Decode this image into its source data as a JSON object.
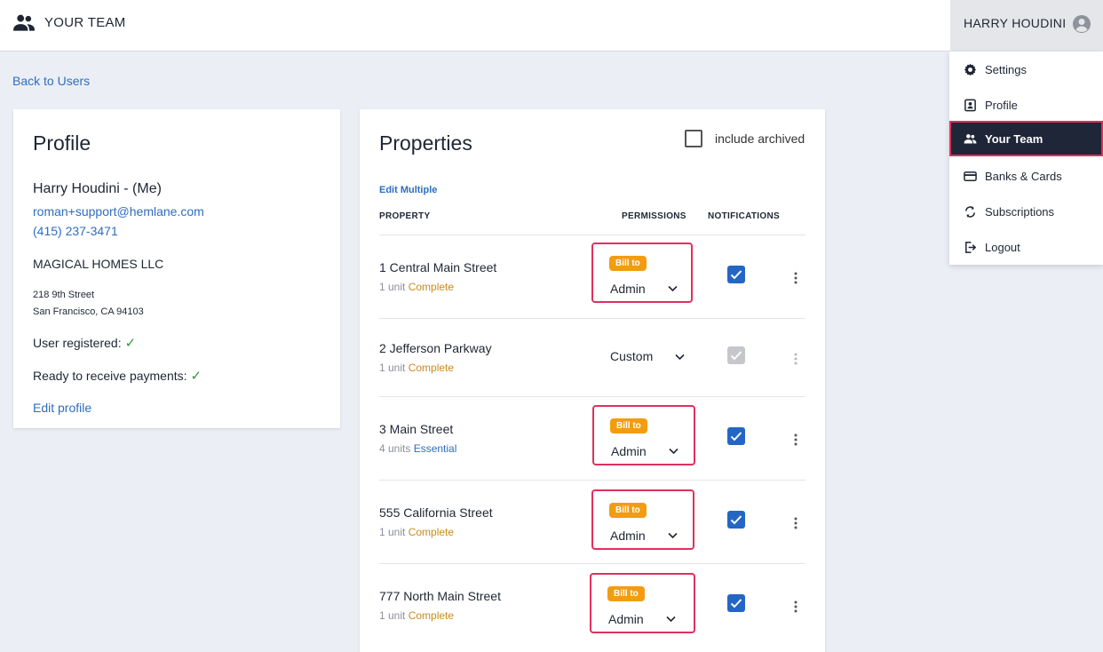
{
  "header": {
    "title": "YOUR TEAM",
    "user_name": "HARRY HOUDINI"
  },
  "menu": {
    "items": [
      {
        "label": "Settings",
        "icon": "gear-icon"
      },
      {
        "label": "Profile",
        "icon": "profile-card-icon"
      },
      {
        "label": "Your Team",
        "icon": "team-icon",
        "active": true
      },
      {
        "label": "Banks & Cards",
        "icon": "credit-card-icon"
      },
      {
        "label": "Subscriptions",
        "icon": "refresh-icon"
      },
      {
        "label": "Logout",
        "icon": "logout-icon"
      }
    ]
  },
  "back_link": "Back to Users",
  "profile": {
    "heading": "Profile",
    "name": "Harry Houdini - (Me)",
    "email": "roman+support@hemlane.com",
    "phone": "(415) 237-3471",
    "company": "MAGICAL HOMES LLC",
    "address_line1": "218 9th Street",
    "address_line2": "San Francisco, CA 94103",
    "registered_label": "User registered:",
    "payments_label": "Ready to receive payments:",
    "check_glyph": "✓",
    "edit_label": "Edit profile"
  },
  "properties": {
    "heading": "Properties",
    "include_archived_label": "include archived",
    "edit_multiple_label": "Edit Multiple",
    "columns": {
      "property": "PROPERTY",
      "permissions": "PERMISSIONS",
      "notifications": "NOTIFICATIONS"
    },
    "rows": [
      {
        "name": "1 Central Main Street",
        "units": "1 unit",
        "plan": "Complete",
        "bill_to": "Bill to",
        "permission": "Admin",
        "notifications": true
      },
      {
        "name": "2 Jefferson Parkway",
        "units": "1 unit",
        "plan": "Complete",
        "permission": "Custom",
        "notifications": true
      },
      {
        "name": "3 Main Street",
        "units": "4 units",
        "plan": "Essential",
        "bill_to": "Bill to",
        "permission": "Admin",
        "notifications": true
      },
      {
        "name": "555 California Street",
        "units": "1 unit",
        "plan": "Complete",
        "bill_to": "Bill to",
        "permission": "Admin",
        "notifications": true
      },
      {
        "name": "777 North Main Street",
        "units": "1 unit",
        "plan": "Complete",
        "bill_to": "Bill to",
        "permission": "Admin",
        "notifications": true
      }
    ]
  },
  "colors": {
    "accent": "#2466c4",
    "highlight": "#e0305e",
    "badge": "#f39c12",
    "menu_active": "#1f2638"
  }
}
